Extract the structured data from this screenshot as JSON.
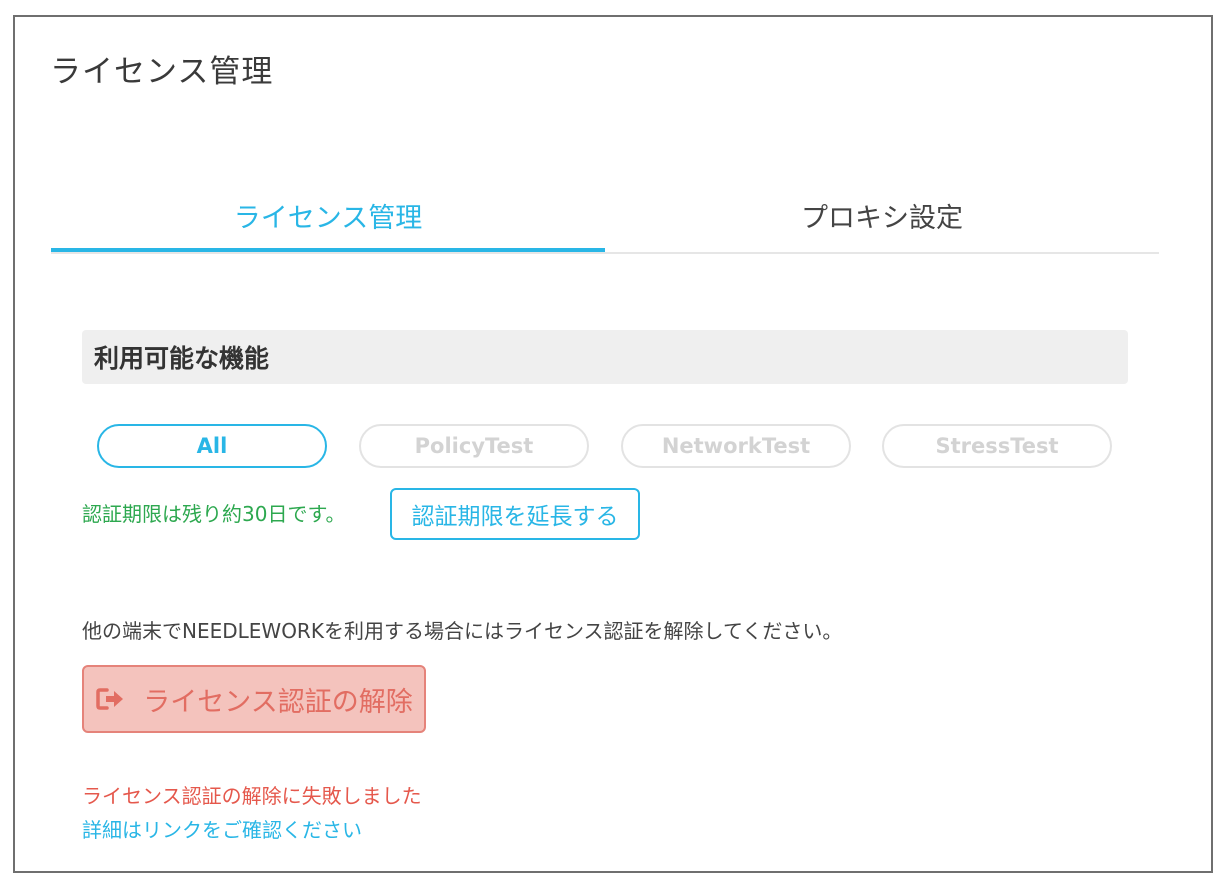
{
  "page_title": "ライセンス管理",
  "tabs": [
    {
      "label": "ライセンス管理",
      "active": true
    },
    {
      "label": "プロキシ設定",
      "active": false
    }
  ],
  "features": {
    "header": "利用可能な機能",
    "filters": [
      {
        "label": "All",
        "active": true
      },
      {
        "label": "PolicyTest",
        "active": false
      },
      {
        "label": "NetworkTest",
        "active": false
      },
      {
        "label": "StressTest",
        "active": false
      }
    ]
  },
  "expiry": {
    "text": "認証期限は残り約30日です。",
    "extend_button": "認証期限を延長する"
  },
  "release": {
    "info": "他の端末でNEEDLEWORKを利用する場合にはライセンス認証を解除してください。",
    "button_label": "ライセンス認証の解除",
    "button_icon": "sign-out-icon",
    "error_message": "ライセンス認証の解除に失敗しました",
    "detail_link": "詳細はリンクをご確認ください"
  },
  "colors": {
    "accent": "#29b6e6",
    "success": "#2da84f",
    "danger": "#e5584c",
    "danger_bg": "#f4c3bd"
  }
}
